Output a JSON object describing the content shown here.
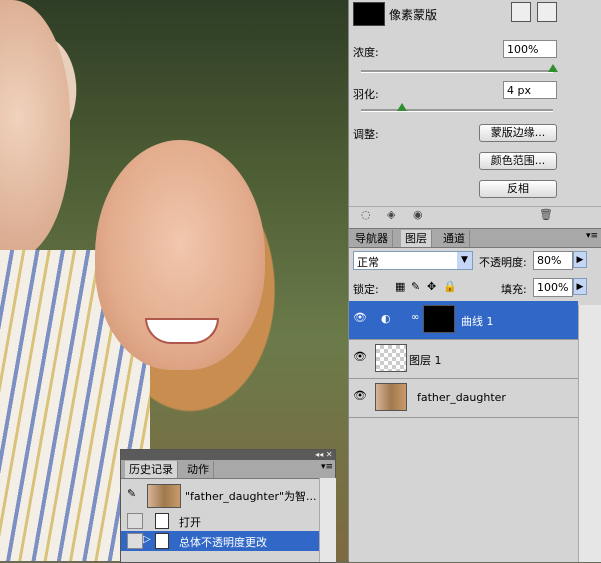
{
  "masks": {
    "title": "像素蒙版",
    "density_label": "浓度:",
    "density_value": "100%",
    "density_level_percent": 100,
    "feather_label": "羽化:",
    "feather_value": "4 px",
    "adjust_label": "调整:",
    "buttons": [
      "蒙版边缘...",
      "颜色范围...",
      "反相"
    ]
  },
  "layers_panel": {
    "tabs": [
      "导航器",
      "图层",
      "通道"
    ],
    "active_tab": "图层",
    "blend_mode": "正常",
    "opacity_label": "不透明度:",
    "opacity_value": "80%",
    "lock_label": "锁定:",
    "fill_label": "填充:",
    "fill_value": "100%",
    "layers": [
      {
        "name": "曲线 1",
        "selected": true
      },
      {
        "name": "图层 1",
        "selected": false
      },
      {
        "name": "father_daughter",
        "selected": false
      }
    ]
  },
  "history_panel": {
    "tabs": [
      "历史记录",
      "动作"
    ],
    "snapshot_label": "\"father_daughter\"为智...",
    "items": [
      {
        "label": "打开",
        "selected": false
      },
      {
        "label": "总体不透明度更改",
        "selected": true
      }
    ]
  },
  "colors": {
    "selection": "#3168c7",
    "panel_bg": "#d4d4d4",
    "slider_knob": "#2f8f2f"
  }
}
